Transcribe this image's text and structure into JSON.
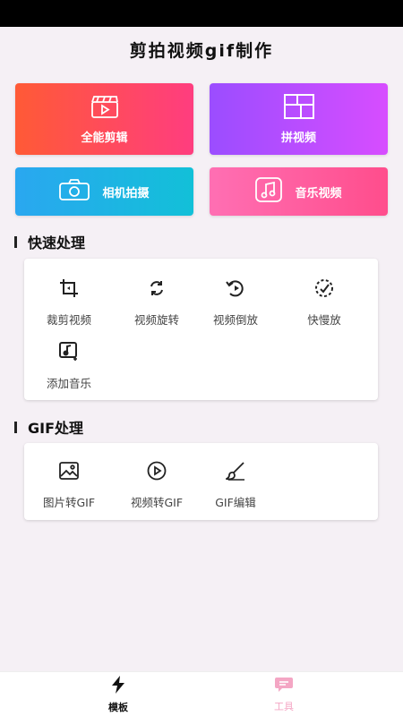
{
  "app": {
    "title": "剪拍视频gif制作"
  },
  "feature_cards": [
    {
      "label": "全能剪辑",
      "icon": "clapperboard-icon",
      "gradient": [
        "#ff5a36",
        "#ff3d7f"
      ]
    },
    {
      "label": "拼视频",
      "icon": "grid-layout-icon",
      "gradient": [
        "#9b4dff",
        "#d74dff"
      ]
    },
    {
      "label": "相机拍摄",
      "icon": "camera-icon",
      "gradient": [
        "#2aa7f0",
        "#12c0d8"
      ]
    },
    {
      "label": "音乐视频",
      "icon": "music-note-icon",
      "gradient": [
        "#ff6fb3",
        "#ff4d8c"
      ]
    }
  ],
  "quick_section": {
    "title": "快速处理",
    "tools": [
      {
        "label": "裁剪视频",
        "icon": "crop-icon"
      },
      {
        "label": "视频旋转",
        "icon": "rotate-icon"
      },
      {
        "label": "视频倒放",
        "icon": "rewind-icon"
      },
      {
        "label": "快慢放",
        "icon": "speed-icon"
      },
      {
        "label": "添加音乐",
        "icon": "add-music-icon"
      }
    ]
  },
  "gif_section": {
    "title": "GIF处理",
    "tools": [
      {
        "label": "图片转GIF",
        "icon": "image-icon"
      },
      {
        "label": "视频转GIF",
        "icon": "play-circle-icon"
      },
      {
        "label": "GIF编辑",
        "icon": "brush-icon"
      }
    ]
  },
  "bottom_nav": {
    "items": [
      {
        "label": "模板",
        "icon": "lightning-icon",
        "active": true
      },
      {
        "label": "工具",
        "icon": "chat-bubble-icon",
        "active": false
      }
    ],
    "active_color": "#111111",
    "inactive_color": "#f4a6c4"
  }
}
